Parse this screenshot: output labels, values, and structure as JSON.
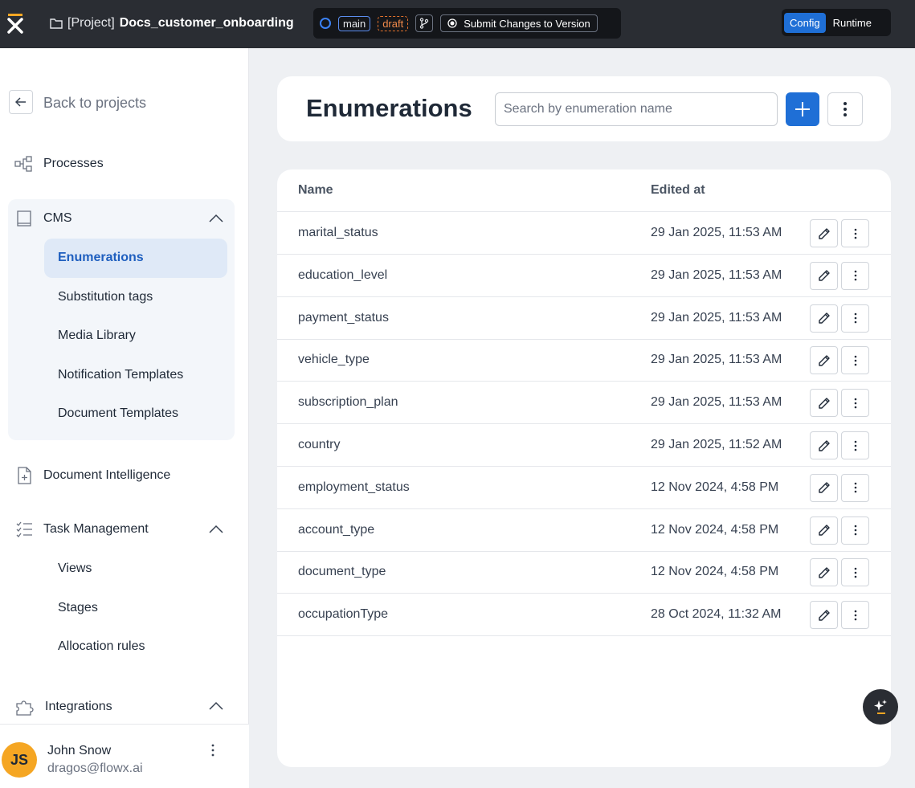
{
  "topbar": {
    "project_prefix": "[Project]",
    "project_name": "Docs_customer_onboarding",
    "branch": "main",
    "status": "draft",
    "submit_label": "Submit Changes to Version",
    "mode_config": "Config",
    "mode_runtime": "Runtime"
  },
  "sidebar": {
    "back_label": "Back to projects",
    "processes": "Processes",
    "cms": "CMS",
    "cms_items": [
      "Enumerations",
      "Substitution tags",
      "Media Library",
      "Notification Templates",
      "Document Templates"
    ],
    "document_intelligence": "Document Intelligence",
    "task_management": "Task Management",
    "task_items": [
      "Views",
      "Stages",
      "Allocation rules"
    ],
    "integrations": "Integrations"
  },
  "user": {
    "initials": "JS",
    "name": "John Snow",
    "email": "dragos@flowx.ai"
  },
  "header": {
    "title": "Enumerations",
    "search_placeholder": "Search by enumeration name"
  },
  "table": {
    "columns": [
      "Name",
      "Edited at"
    ],
    "rows": [
      {
        "name": "marital_status",
        "edited": "29 Jan 2025, 11:53 AM"
      },
      {
        "name": "education_level",
        "edited": "29 Jan 2025, 11:53 AM"
      },
      {
        "name": "payment_status",
        "edited": "29 Jan 2025, 11:53 AM"
      },
      {
        "name": "vehicle_type",
        "edited": "29 Jan 2025, 11:53 AM"
      },
      {
        "name": "subscription_plan",
        "edited": "29 Jan 2025, 11:53 AM"
      },
      {
        "name": "country",
        "edited": "29 Jan 2025, 11:52 AM"
      },
      {
        "name": "employment_status",
        "edited": "12 Nov 2024, 4:58 PM"
      },
      {
        "name": "account_type",
        "edited": "12 Nov 2024, 4:58 PM"
      },
      {
        "name": "document_type",
        "edited": "12 Nov 2024, 4:58 PM"
      },
      {
        "name": "occupationType",
        "edited": "28 Oct 2024, 11:32 AM"
      }
    ]
  },
  "colors": {
    "accent": "#1f6fd6",
    "topbar_bg": "#2a2d33",
    "active_nav_bg": "#dfe9f7",
    "avatar_bg": "#f5a623",
    "draft_orange": "#e0702b"
  }
}
